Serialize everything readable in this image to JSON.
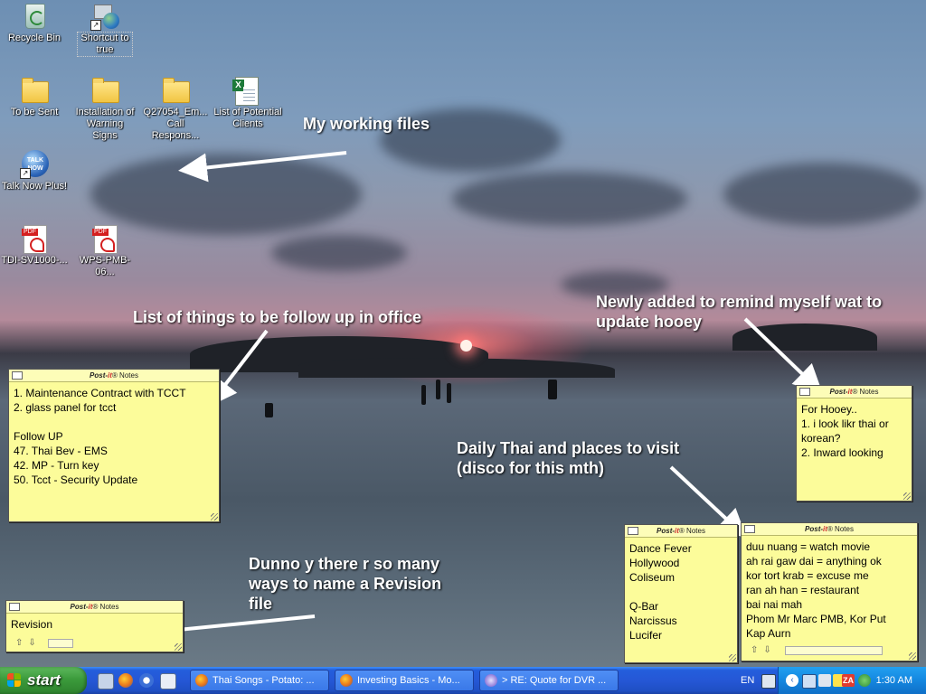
{
  "desktop": {
    "icons": [
      {
        "label": "Recycle Bin",
        "icon": "recycle-bin-icon"
      },
      {
        "label": "Shortcut to true",
        "icon": "computer-shortcut-icon"
      },
      {
        "label": "To be Sent",
        "icon": "folder-icon"
      },
      {
        "label": "Installation of Warning Signs",
        "icon": "folder-icon"
      },
      {
        "label": "Q27054_Em... Call Respons...",
        "icon": "folder-icon"
      },
      {
        "label": "List of Potential Clients",
        "icon": "excel-file-icon"
      },
      {
        "label": "Talk Now Plus!",
        "icon": "talk-now-icon"
      },
      {
        "label": "TDI-SV1000-...",
        "icon": "pdf-file-icon"
      },
      {
        "label": "WPS-PMB-06...",
        "icon": "pdf-file-icon"
      }
    ],
    "annotations": [
      "My working files",
      "List of things to be follow up in office",
      "Newly added to remind myself wat to\nupdate hooey",
      "Daily Thai and places to visit\n(disco for this mth)",
      "Dunno y there r so many\nways to name a Revision\nfile"
    ]
  },
  "notes": {
    "brand_prefix": "Post-",
    "brand_it": "it",
    "brand_suffix": "® Notes",
    "followup": "1. Maintenance Contract with TCCT\n2. glass panel for tcct\n\nFollow UP\n47. Thai Bev - EMS\n42. MP - Turn key\n50. Tcct - Security Update",
    "hooey": "For Hooey..\n1. i look likr thai or korean?\n2. Inward looking",
    "places": "Dance Fever\nHollywood\nColiseum\n\nQ-Bar\nNarcissus\nLucifer",
    "thai": "duu nuang = watch movie\nah rai gaw dai = anything ok\nkor tort krab = excuse me\nran ah han = restaurant\nbai nai mah\nPhom Mr Marc PMB, Kor Put\nKap Aurn",
    "revision": "Revision"
  },
  "taskbar": {
    "start_label": "start",
    "tasks": [
      "Thai Songs - Potato: ...",
      "Investing Basics - Mo...",
      "> RE: Quote for DVR ..."
    ],
    "language": "EN",
    "clock": "1:30 AM"
  }
}
